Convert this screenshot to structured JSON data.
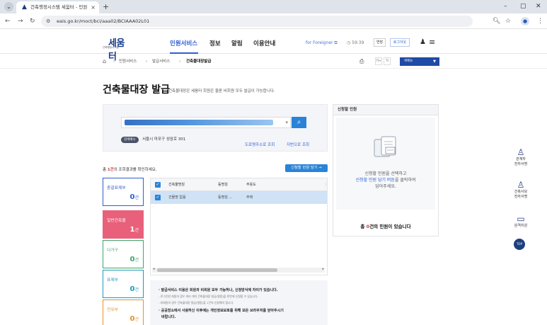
{
  "browser": {
    "tab_title": "건축행정시스템 세움터 - 민원",
    "tab_close": "×",
    "new_tab": "+",
    "url": "eais.go.kr/moct/bci/aaa02/BCIAAA02L01",
    "controls": {
      "back": "←",
      "forward": "→",
      "reload": "↻",
      "minimize": "–",
      "maximize": "▢",
      "close": "✕",
      "zoom": "🔍︎",
      "star": "☆",
      "menu": "⋮",
      "tab_list": "⌄"
    }
  },
  "header": {
    "logo": "세움터",
    "logo_sub": "건축행정시스템",
    "nav": [
      "민원서비스",
      "정보",
      "알림",
      "이용안내"
    ],
    "foreigner": "for Foreigner ⧉",
    "timer": "◷ 59:39",
    "extend_button": "연장",
    "logout_button": "로그아웃"
  },
  "breadcrumb": {
    "items": [
      "민원서비스",
      "발급서비스",
      "건축물대장발급"
    ],
    "zoom_in": "가+",
    "zoom_out": "가",
    "quick_menu": "퀵메뉴"
  },
  "page": {
    "title": "건축물대장 발급",
    "description": "건축물대장은 세움터 회원은 물론 비회원 모두 발급이 가능합니다."
  },
  "search": {
    "example_badge": "검색예시",
    "example_text": "서울시 마포구 성암로 301",
    "road_search_link": "도로명주소로 조회",
    "lot_search_link": "지번으로 조회"
  },
  "results": {
    "count_prefix": "총 ",
    "count_value": "1건",
    "count_suffix": "의 조회결과를 확인하세요.",
    "add_button": "신청할 민원 담기 →",
    "categories": [
      {
        "label": "총괄표제부",
        "count": "0",
        "unit": "건",
        "color": "#2d5fd3"
      },
      {
        "label": "일반건축물",
        "count": "1",
        "unit": "건",
        "color": "#e8607a",
        "active": true
      },
      {
        "label": "다가구",
        "count": "0",
        "unit": "건",
        "color": "#3aa66b"
      },
      {
        "label": "표제부",
        "count": "0",
        "unit": "건",
        "color": "#1e9ab8"
      },
      {
        "label": "전유부",
        "count": "0",
        "unit": "건",
        "color": "#e8902a"
      }
    ],
    "table": {
      "headers": [
        "건축물명칭",
        "동명칭",
        "주용도"
      ],
      "rows": [
        {
          "name": "건물명 없음",
          "dong": "동명칭 ...",
          "use": "주택"
        }
      ]
    }
  },
  "notice": {
    "lines": [
      {
        "text": "· 발급서비스 이용은 회원과 비회원 모두 가능하나, 신청방식에 차이가 있습니다.",
        "style": "bold"
      },
      {
        "text": "- 로그인한 회원의 경우 여러 개의 건축물대장 발급(열람)을 한번에 신청할 수 있습니다.",
        "style": "sub"
      },
      {
        "text": "- 비회원의 경우 건축물대장 발급(열람)을 1건씩 신청해야 합니다.",
        "style": "sub"
      },
      {
        "text": "· 공공장소에서 사용하신 이후에는 개인정보보호를 위해 모든 브라우저를 닫아주시기",
        "style": "bold"
      },
      {
        "text": "바랍니다.",
        "style": "bold"
      }
    ]
  },
  "apply_panel": {
    "title": "신청할 민원",
    "empty_line1": "신청할 민원을 선택하고",
    "empty_link": "신청할 민원 담기 버튼",
    "empty_line2_suffix": "을 클릭하여",
    "empty_line3": "담아주세요.",
    "total_prefix": "총 ",
    "total_value": "0",
    "total_suffix": "건의 민원이 있습니다"
  },
  "side_menu": [
    {
      "label1": "관계자",
      "label2": "전자서명",
      "icon": "person-icon"
    },
    {
      "label1": "건축사보",
      "label2": "전자서명",
      "icon": "person-icon"
    },
    {
      "label1": "원격지원",
      "label2": "",
      "icon": "monitor-icon"
    }
  ],
  "top_button": "TOP"
}
